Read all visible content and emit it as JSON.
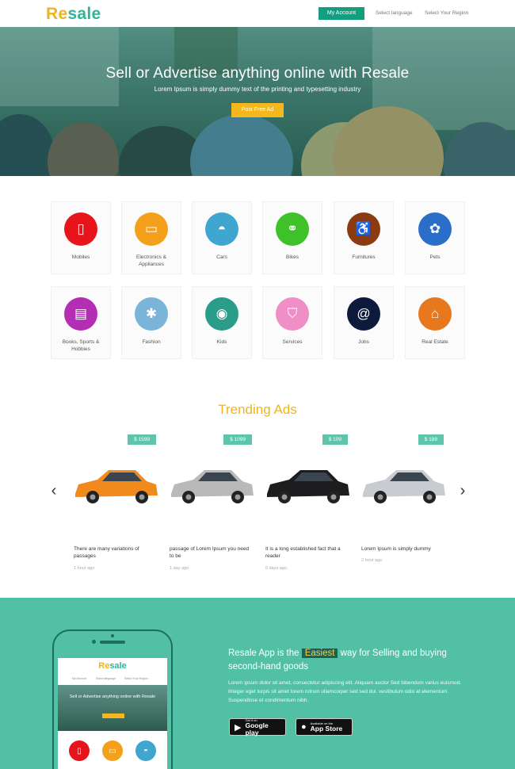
{
  "header": {
    "logo_first": "Re",
    "logo_second": "sale",
    "my_account": "My Account",
    "select_language": "Select language",
    "select_region": "Select Your Region"
  },
  "hero": {
    "title": "Sell or Advertise anything online with Resale",
    "subtitle": "Lorem Ipsum is simply dummy text of the printing and typesetting industry",
    "post_button": "Post Free Ad"
  },
  "categories": [
    {
      "label": "Mobiles",
      "icon": "mobile-icon",
      "color": "#e8141b"
    },
    {
      "label": "Electronics & Appliances",
      "icon": "laptop-icon",
      "color": "#f5a01a"
    },
    {
      "label": "Cars",
      "icon": "car-icon",
      "color": "#3fa6cf"
    },
    {
      "label": "Bikes",
      "icon": "bike-icon",
      "color": "#3ec129"
    },
    {
      "label": "Furnitures",
      "icon": "wheelchair-icon",
      "color": "#8b3a12"
    },
    {
      "label": "Pets",
      "icon": "paw-icon",
      "color": "#2b6ec9"
    },
    {
      "label": "Books, Sports & Hobbies",
      "icon": "book-icon",
      "color": "#b42db5"
    },
    {
      "label": "Fashion",
      "icon": "asterisk-icon",
      "color": "#7ab4d8"
    },
    {
      "label": "Kids",
      "icon": "gamepad-icon",
      "color": "#2a9d8a"
    },
    {
      "label": "Services",
      "icon": "shield-icon",
      "color": "#f08fc7"
    },
    {
      "label": "Jobs",
      "icon": "at-icon",
      "color": "#0e1a3c"
    },
    {
      "label": "Real Estate",
      "icon": "home-icon",
      "color": "#e8781e"
    }
  ],
  "trending": {
    "title": "Trending Ads",
    "ads": [
      {
        "price": "$ 1599",
        "desc": "There are many variations of passages",
        "time": "1 hour ago",
        "car_color": "#f08a1c"
      },
      {
        "price": "$ 1099",
        "desc": "passage of Lorem Ipsum you need to be",
        "time": "1 day ago",
        "car_color": "#b9b9b9"
      },
      {
        "price": "$ 109",
        "desc": "It is a long established fact that a reader",
        "time": "5 days ago",
        "car_color": "#1d1d1f"
      },
      {
        "price": "$ 189",
        "desc": "Lorem Ipsum is simply dummy",
        "time": "2 hour ago",
        "car_color": "#c8ccd0"
      }
    ]
  },
  "app": {
    "title_before": "Resale App is the",
    "title_highlight": "Easiest",
    "title_after": "way for Selling and buying second-hand goods",
    "body": "Lorem ipsum dolor sit amet, consectetur adipiscing elit. Aliquam auctor Sed bibendum varius euismod. Integer eget turpis sit amet lorem rutrum ullamcorper sed sed dui. vestibulum odio at elementum. Suspendisse et condimentum nibh.",
    "google_small": "Get it on",
    "google_big": "Google play",
    "apple_small": "Available on the",
    "apple_big": "App Store",
    "phone_title": "Sell or Advertise anything online with Resale",
    "phone_nav_account": "My Account",
    "phone_nav_language": "Select language",
    "phone_nav_region": "Select Your Region"
  }
}
